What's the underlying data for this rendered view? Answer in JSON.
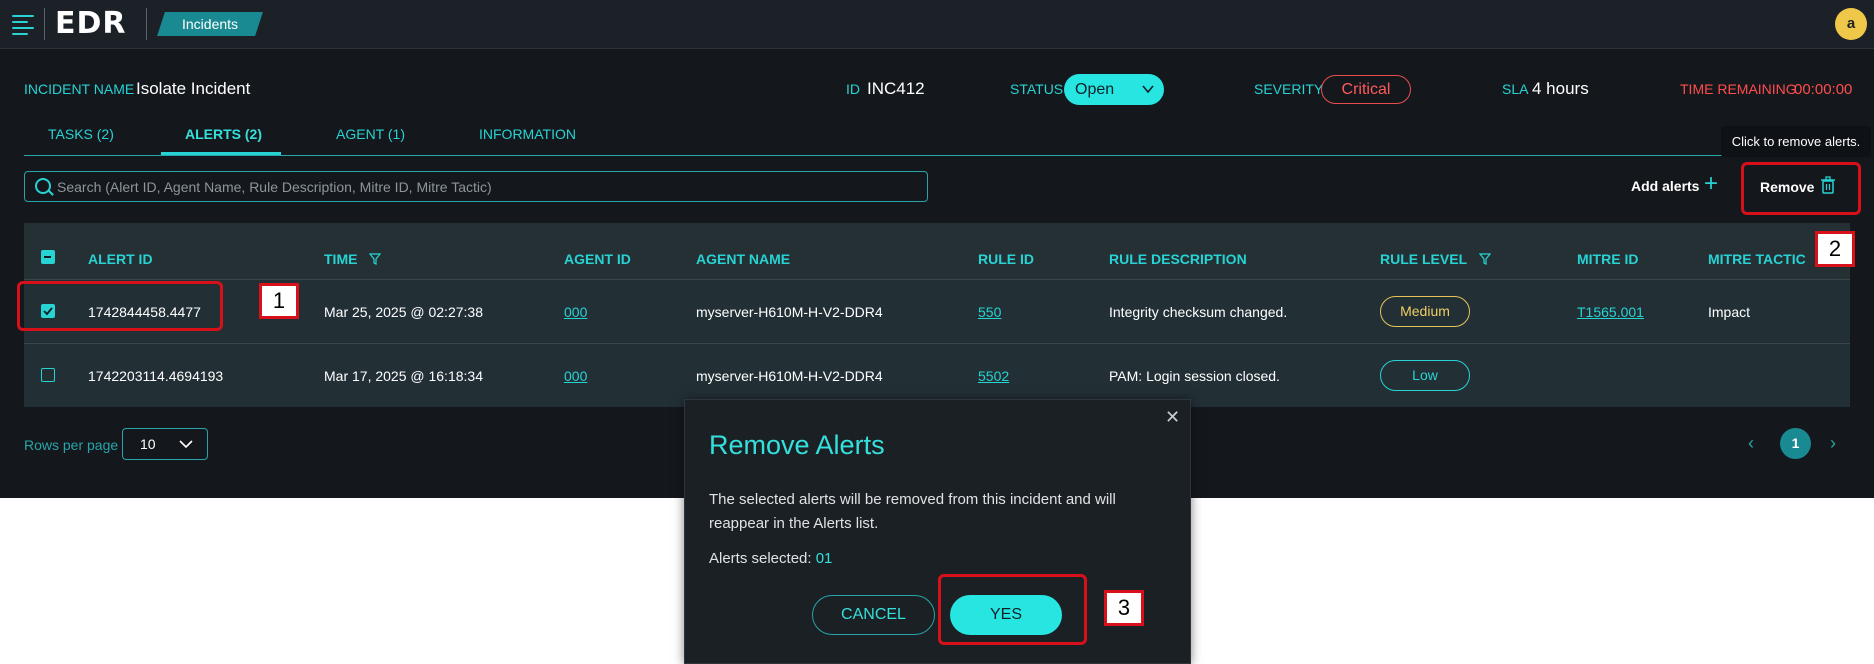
{
  "topbar": {
    "logo": "EDR",
    "breadcrumb": "Incidents",
    "avatar_initial": "a"
  },
  "incident": {
    "name_label": "INCIDENT NAME",
    "name": "Isolate Incident",
    "id_label": "ID",
    "id": "INC412",
    "status_label": "STATUS",
    "status": "Open",
    "severity_label": "SEVERITY",
    "severity": "Critical",
    "sla_label": "SLA",
    "sla": "4 hours",
    "time_label": "TIME REMAINING",
    "time": "00:00:00"
  },
  "tabs": [
    "TASKS (2)",
    "ALERTS (2)",
    "AGENT (1)",
    "INFORMATION"
  ],
  "search": {
    "placeholder": "Search (Alert ID, Agent Name, Rule Description, Mitre ID, Mitre Tactic)"
  },
  "actions": {
    "add_alerts": "Add alerts",
    "remove": "Remove",
    "tooltip": "Click to remove alerts."
  },
  "table": {
    "headers": [
      "ALERT ID",
      "TIME",
      "AGENT ID",
      "AGENT NAME",
      "RULE ID",
      "RULE DESCRIPTION",
      "RULE LEVEL",
      "MITRE ID",
      "MITRE TACTIC"
    ],
    "rows": [
      {
        "alert_id": "1742844458.4477",
        "time": "Mar 25, 2025 @ 02:27:38",
        "agent_id": "000",
        "agent_name": "myserver-H610M-H-V2-DDR4",
        "rule_id": "550",
        "rule_description": "Integrity checksum changed.",
        "rule_level": "Medium",
        "mitre_id": "T1565.001",
        "mitre_tactic": "Impact"
      },
      {
        "alert_id": "1742203114.4694193",
        "time": "Mar 17, 2025 @ 16:18:34",
        "agent_id": "000",
        "agent_name": "myserver-H610M-H-V2-DDR4",
        "rule_id": "5502",
        "rule_description": "PAM: Login session closed.",
        "rule_level": "Low",
        "mitre_id": "",
        "mitre_tactic": ""
      }
    ]
  },
  "pagination": {
    "rows_label": "Rows per page",
    "rows_value": "10",
    "current_page": "1"
  },
  "modal": {
    "title": "Remove Alerts",
    "body": "The selected alerts will be removed from this incident and will reappear in the Alerts list.",
    "selected_label": "Alerts selected:",
    "selected_count": "01",
    "cancel": "CANCEL",
    "yes": "YES"
  },
  "annotations": [
    "1",
    "2",
    "3"
  ],
  "colors": {
    "accent": "#27d3d3",
    "highlight": "#d8101a",
    "critical": "#ff5a5a",
    "medium": "#f0ce62"
  }
}
